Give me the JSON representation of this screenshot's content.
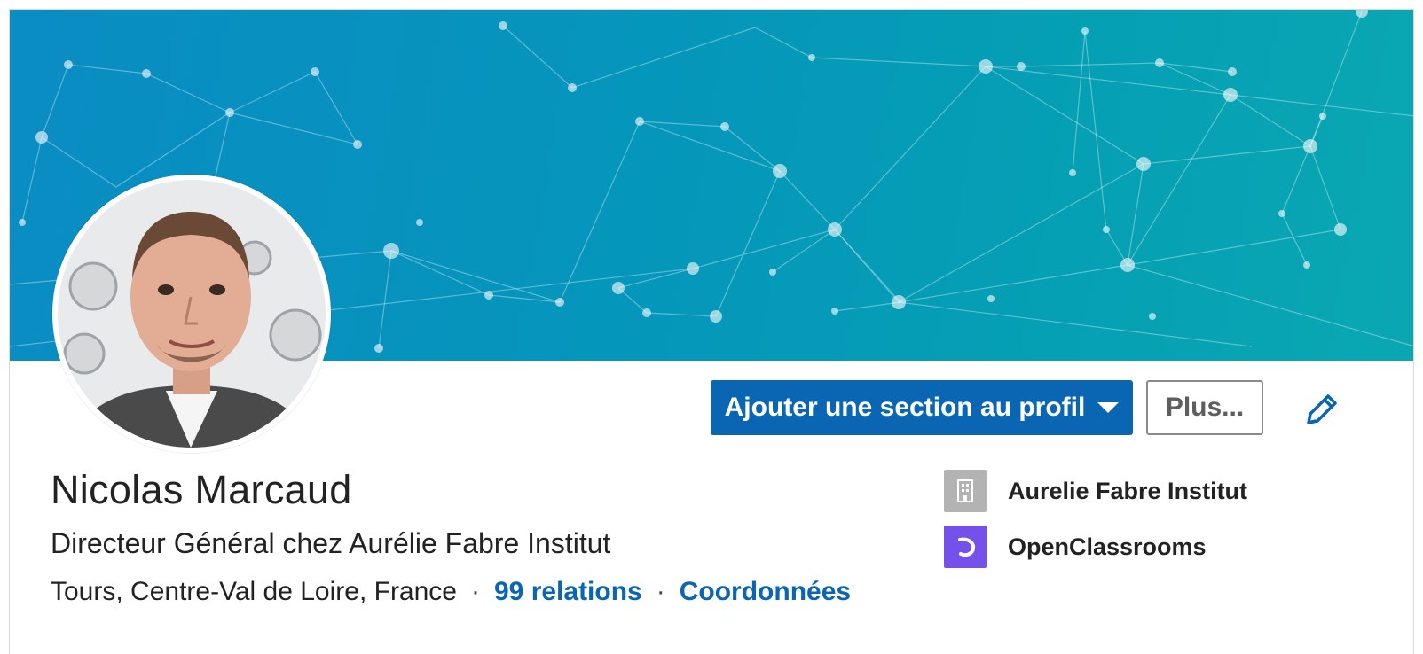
{
  "profile": {
    "name": "Nicolas Marcaud",
    "headline": "Directeur Général chez Aurélie Fabre Institut",
    "location": "Tours, Centre-Val de Loire, France",
    "separator": "·",
    "connections_label": "99 relations",
    "contact_label": "Coordonnées"
  },
  "actions": {
    "add_section_label": "Ajouter une section au profil",
    "more_label": "Plus..."
  },
  "organizations": [
    {
      "label": "Aurelie Fabre Institut",
      "icon": "building-icon"
    },
    {
      "label": "OpenClassrooms",
      "icon": "openclassrooms-logo"
    }
  ],
  "colors": {
    "primary": "#0a66b2",
    "banner_start": "#0a8cc4",
    "banner_end": "#0aa7b3",
    "openclassrooms": "#7451eb",
    "building_bg": "#b3b3b3"
  }
}
